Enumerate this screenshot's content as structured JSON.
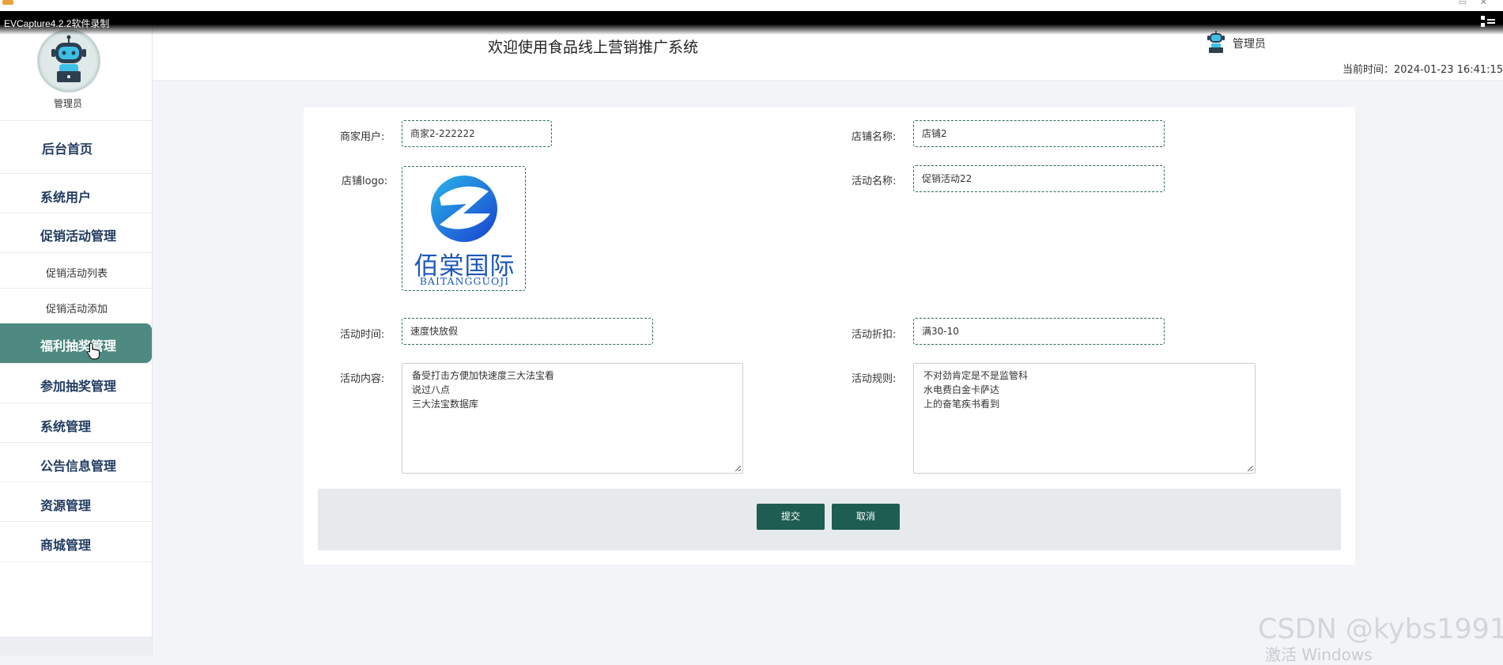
{
  "recorder": {
    "title": "EVCapture4.2.2软件录制"
  },
  "sidebar": {
    "admin_name": "管理员",
    "items": [
      {
        "label": "后台首页"
      },
      {
        "label": "系统用户"
      },
      {
        "label": "促销活动管理"
      },
      {
        "label": "促销活动列表"
      },
      {
        "label": "促销活动添加"
      },
      {
        "label": "福利抽奖管理"
      },
      {
        "label": "参加抽奖管理"
      },
      {
        "label": "系统管理"
      },
      {
        "label": "公告信息管理"
      },
      {
        "label": "资源管理"
      },
      {
        "label": "商城管理"
      }
    ]
  },
  "header": {
    "welcome": "欢迎使用食品线上营销推广系统",
    "admin_name": "管理员",
    "time_label": "当前时间：",
    "time_value": "2024-01-23 16:41:15"
  },
  "form": {
    "merchant_user": {
      "label": "商家用户:",
      "value": "商家2-222222"
    },
    "shop_name": {
      "label": "店铺名称:",
      "value": "店铺2"
    },
    "shop_logo": {
      "label": "店铺logo:",
      "logo_cn": "佰棠国际",
      "logo_en": "BAITANGGUOJI"
    },
    "activity_name": {
      "label": "活动名称:",
      "value": "促销活动22"
    },
    "activity_time": {
      "label": "活动时间:",
      "value": "速度快放假"
    },
    "activity_discount": {
      "label": "活动折扣:",
      "value": "满30-10"
    },
    "activity_content": {
      "label": "活动内容:",
      "value": "备受打击方便加快速度三大法宝看\n说过八点\n三大法宝数据库"
    },
    "activity_rules": {
      "label": "活动规则:",
      "value": "不对劲肯定是不是监管科\n水电费白金卡萨达\n上的奋笔疾书看到"
    }
  },
  "buttons": {
    "submit": "提交",
    "cancel": "取消"
  },
  "watermark": {
    "text": "CSDN @kybs1991",
    "os_text": "激活 Windows"
  },
  "colors": {
    "accent": "#1e5d52",
    "active_menu": "#4e8a81",
    "menu_text": "#1f3a5f"
  },
  "icons": {
    "avatar": "robot-avatar-icon",
    "fullscreen": "fullscreen-icon",
    "cursor": "hand-cursor-icon"
  }
}
